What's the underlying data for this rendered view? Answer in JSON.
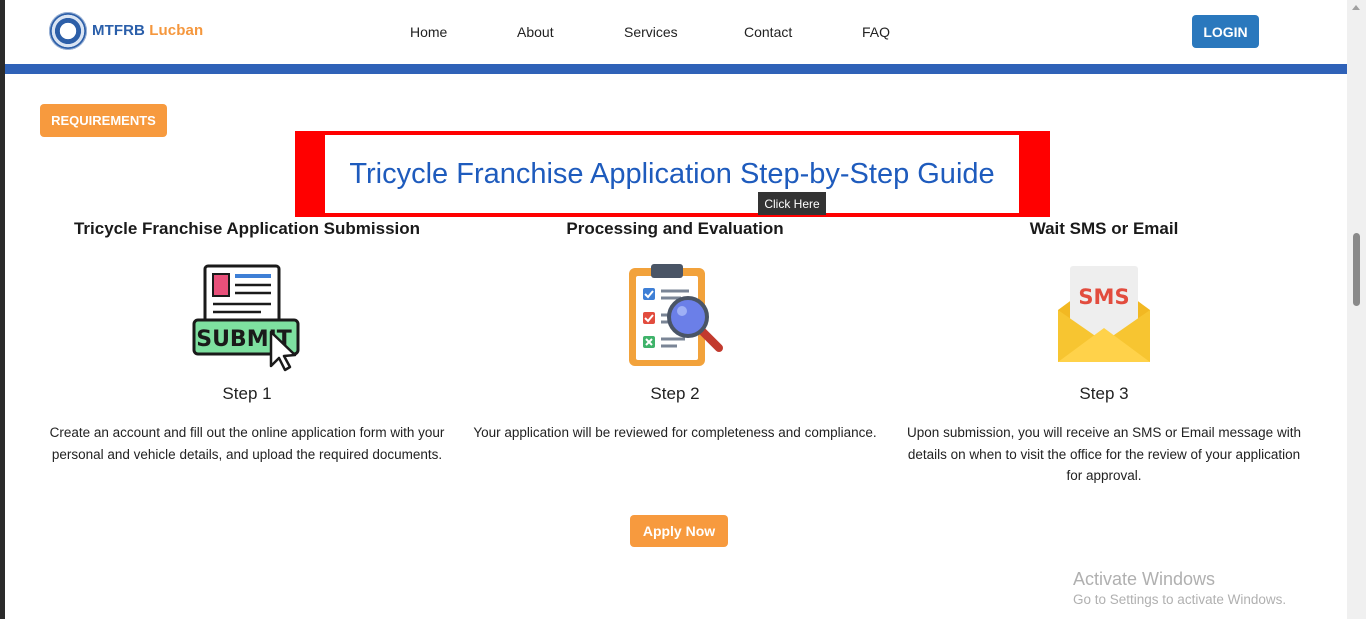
{
  "nav": {
    "logo_text_main": "MTFRB",
    "logo_text_accent": "Lucban",
    "links": [
      "Home",
      "About",
      "Services",
      "Contact",
      "FAQ"
    ],
    "login_label": "LOGIN"
  },
  "requirements_label": "REQUIREMENTS",
  "guide": {
    "title": "Tricycle Franchise Application Step-by-Step Guide",
    "tooltip": "Click Here"
  },
  "steps": [
    {
      "heading": "Tricycle Franchise Application Submission",
      "icon": "submit-icon",
      "label": "Step 1",
      "description": "Create an account and fill out the online application form with your personal and vehicle details, and upload the required documents."
    },
    {
      "heading": "Processing and Evaluation",
      "icon": "clipboard-search-icon",
      "label": "Step 2",
      "description": "Your application will be reviewed for completeness and compliance."
    },
    {
      "heading": "Wait SMS or Email",
      "icon": "sms-envelope-icon",
      "label": "Step 3",
      "description": "Upon submission, you will receive an SMS or Email message with details on when to visit the office for the review of your application for approval.",
      "icon_text": "SMS"
    }
  ],
  "apply_label": "Apply Now",
  "watermark": {
    "title": "Activate Windows",
    "subtitle": "Go to Settings to activate Windows."
  },
  "colors": {
    "accent_orange": "#f79a3e",
    "nav_blue": "#2f62b8",
    "banner_red": "#ff0000",
    "title_blue": "#1e5bbd"
  }
}
